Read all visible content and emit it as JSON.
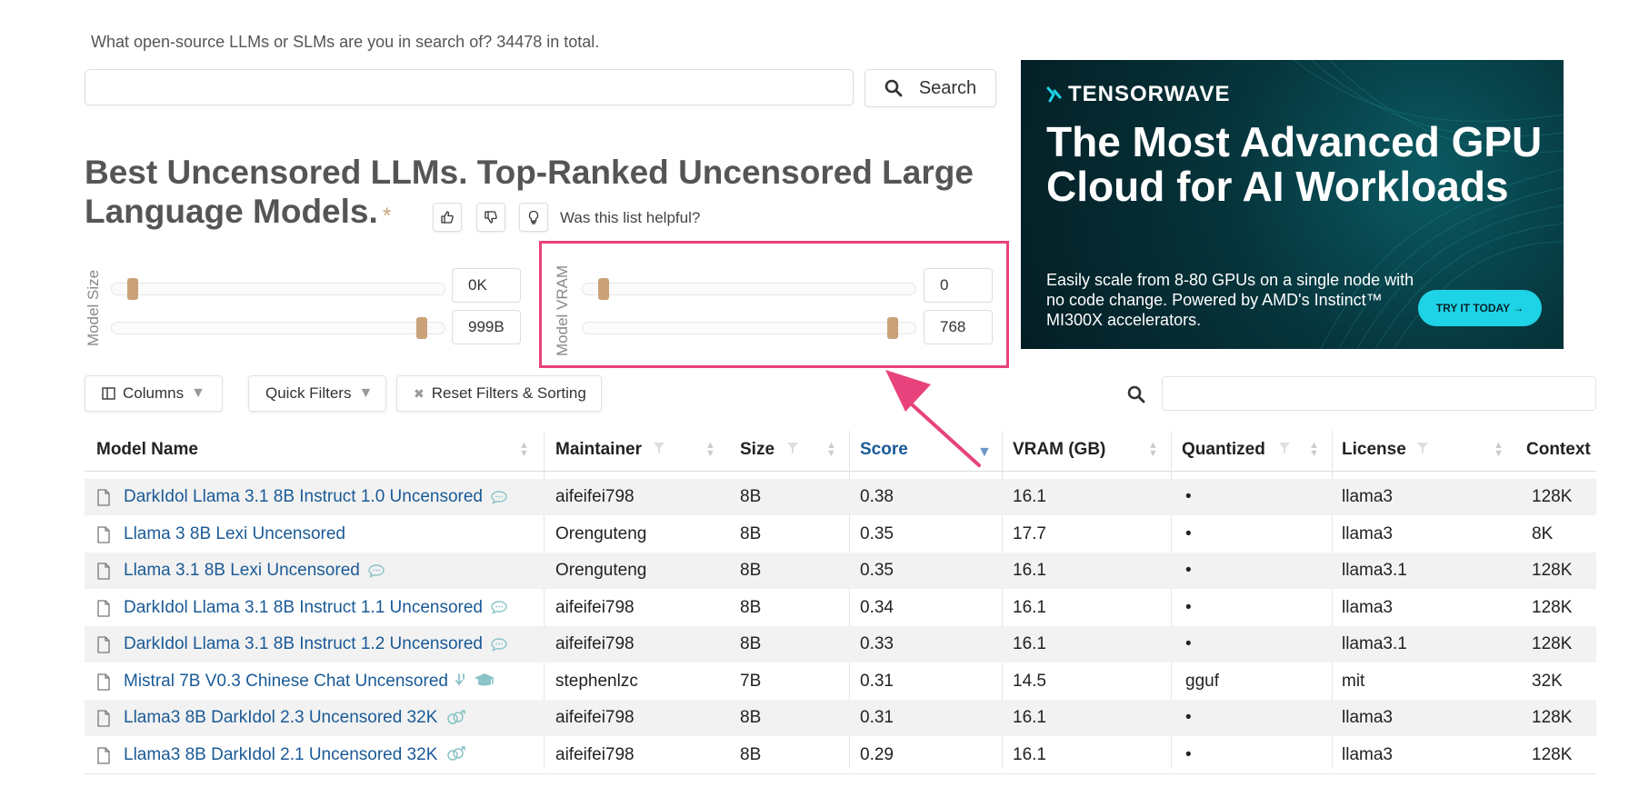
{
  "search": {
    "subtitle": "What open-source LLMs or SLMs are you in search of? 34478 in total.",
    "input_value": "",
    "button_label": "Search"
  },
  "heading": {
    "title": "Best Uncensored LLMs. Top-Ranked Uncensored Large Language Models.",
    "star": "*",
    "feedback_prompt": "Was this list helpful?"
  },
  "filters": {
    "model_size": {
      "label": "Model Size",
      "min": "0K",
      "max": "999B",
      "min_fraction": 0.0,
      "max_fraction": 1.0
    },
    "model_vram": {
      "label": "Model VRAM",
      "min": "0",
      "max": "768",
      "min_fraction": 0.0,
      "max_fraction": 1.0
    }
  },
  "ad": {
    "brand": "TENSORWAVE",
    "headline": "The Most Advanced GPU Cloud for AI Workloads",
    "body": "Easily scale from 8-80 GPUs on a single node with no code change. Powered by AMD's Instinct™ MI300X accelerators.",
    "cta": "TRY IT TODAY →",
    "colors": {
      "background": "#04262c",
      "cta": "#1fd3e6"
    }
  },
  "toolbar": {
    "columns_label": "Columns",
    "quick_filters_label": "Quick Filters",
    "reset_label": "Reset Filters & Sorting",
    "table_search_value": ""
  },
  "table": {
    "headers": {
      "model_name": "Model Name",
      "maintainer": "Maintainer",
      "size": "Size",
      "score": "Score",
      "vram": "VRAM (GB)",
      "quantized": "Quantized",
      "license": "License",
      "context": "Context"
    },
    "sorted_by": "score",
    "rows": [
      {
        "name": "DarkIdol Llama 3.1 8B Instruct 1.0 Uncensored",
        "tag": "chat",
        "maintainer": "aifeifei798",
        "size": "8B",
        "score": "0.38",
        "vram": "16.1",
        "quantized": "•",
        "license": "llama3",
        "context": "128K"
      },
      {
        "name": "Llama 3 8B Lexi Uncensored",
        "tag": "",
        "maintainer": "Orenguteng",
        "size": "8B",
        "score": "0.35",
        "vram": "17.7",
        "quantized": "•",
        "license": "llama3",
        "context": "8K"
      },
      {
        "name": "Llama 3.1 8B Lexi Uncensored",
        "tag": "chat",
        "maintainer": "Orenguteng",
        "size": "8B",
        "score": "0.35",
        "vram": "16.1",
        "quantized": "•",
        "license": "llama3.1",
        "context": "128K"
      },
      {
        "name": "DarkIdol Llama 3.1 8B Instruct 1.1 Uncensored",
        "tag": "chat",
        "maintainer": "aifeifei798",
        "size": "8B",
        "score": "0.34",
        "vram": "16.1",
        "quantized": "•",
        "license": "llama3",
        "context": "128K"
      },
      {
        "name": "DarkIdol Llama 3.1 8B Instruct 1.2 Uncensored",
        "tag": "chat",
        "maintainer": "aifeifei798",
        "size": "8B",
        "score": "0.33",
        "vram": "16.1",
        "quantized": "•",
        "license": "llama3.1",
        "context": "128K"
      },
      {
        "name": "Mistral 7B V0.3 Chinese Chat Uncensored",
        "tag": "merge-education",
        "maintainer": "stephenlzc",
        "size": "7B",
        "score": "0.31",
        "vram": "14.5",
        "quantized": "gguf",
        "license": "mit",
        "context": "32K"
      },
      {
        "name": "Llama3 8B DarkIdol 2.3 Uncensored 32K",
        "tag": "roleplay",
        "maintainer": "aifeifei798",
        "size": "8B",
        "score": "0.31",
        "vram": "16.1",
        "quantized": "•",
        "license": "llama3",
        "context": "128K"
      },
      {
        "name": "Llama3 8B DarkIdol 2.1 Uncensored 32K",
        "tag": "roleplay",
        "maintainer": "aifeifei798",
        "size": "8B",
        "score": "0.29",
        "vram": "16.1",
        "quantized": "•",
        "license": "llama3",
        "context": "128K"
      }
    ]
  },
  "annotation": {
    "highlight_color": "#e8427c"
  }
}
